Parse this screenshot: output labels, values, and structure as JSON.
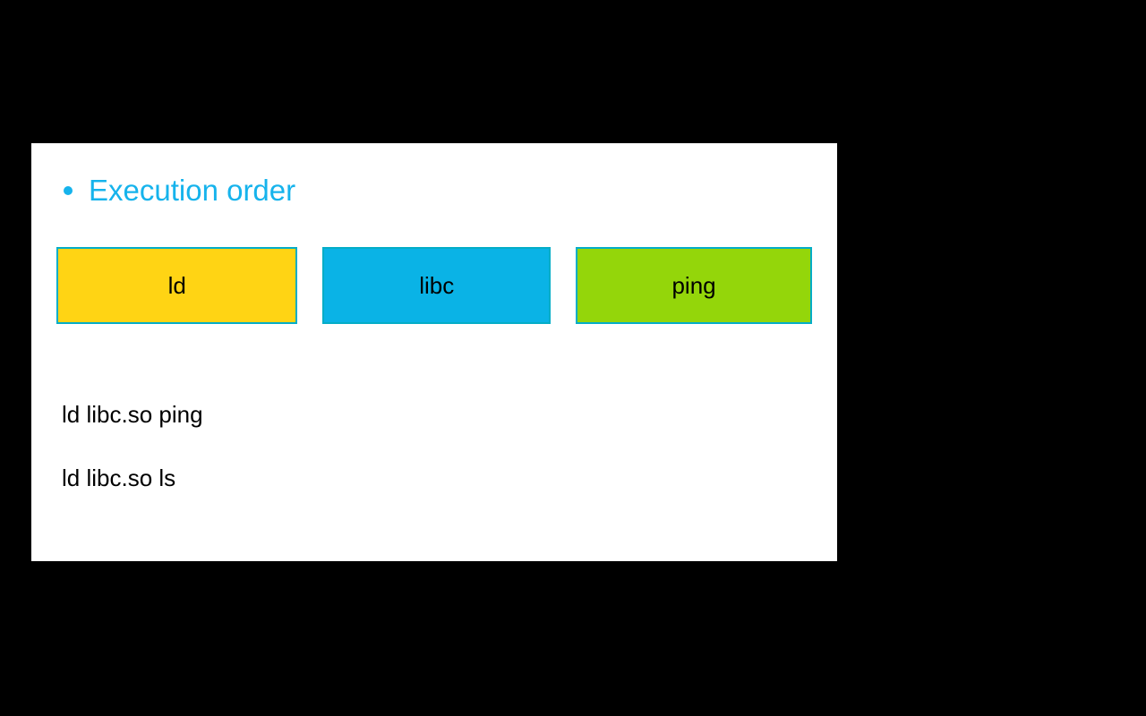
{
  "heading": "Execution order",
  "boxes": {
    "ld": "ld",
    "libc": "libc",
    "ping": "ping"
  },
  "commands": {
    "line1": "ld libc.so ping",
    "line2": "ld libc.so ls"
  }
}
